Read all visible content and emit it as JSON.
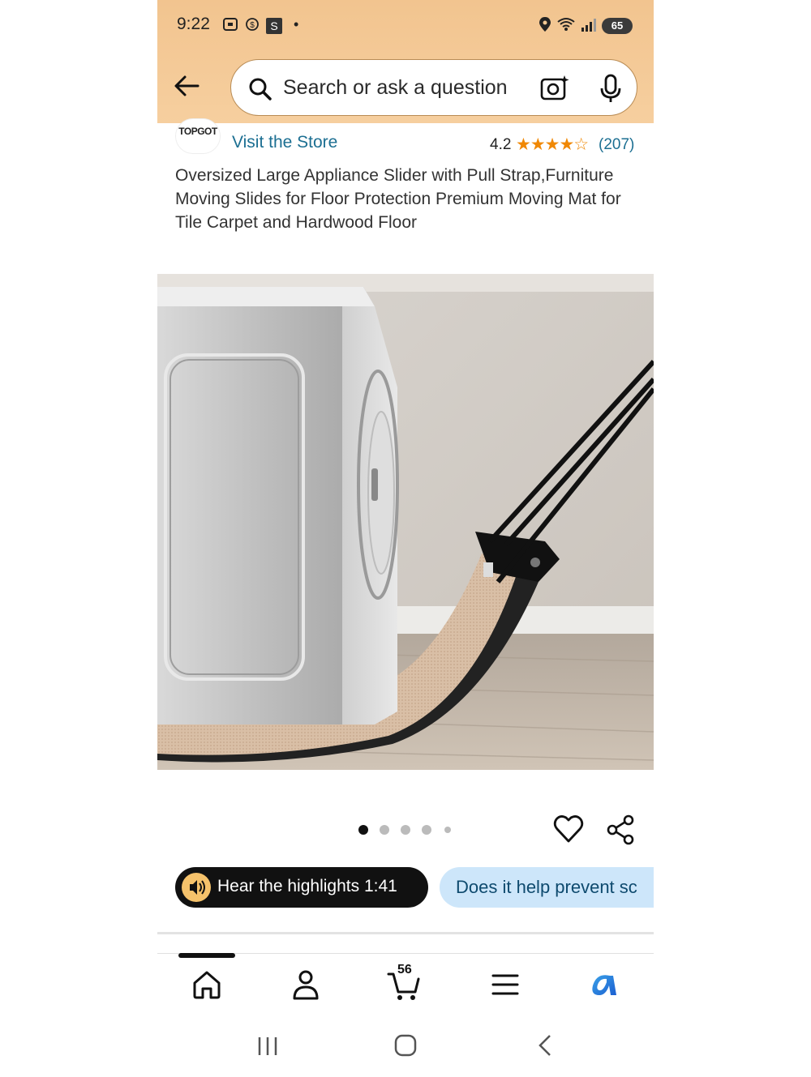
{
  "status_bar": {
    "time": "9:22",
    "notification_letter": "S",
    "battery": "65"
  },
  "search": {
    "placeholder": "Search or ask a question"
  },
  "brand": {
    "logo_text": "TOPGOT",
    "visit_store": "Visit the Store",
    "rating": "4.2",
    "stars": "★★★★☆",
    "review_count": "(207)"
  },
  "product": {
    "title": "Oversized Large Appliance Slider with Pull Strap,Furniture Moving Slides for Floor Protection Premium Moving Mat for Tile Carpet and Hardwood Floor",
    "image_count": 5,
    "active_image": 1
  },
  "actions": {
    "hear_highlights": "Hear the highlights 1:41",
    "question_chip": "Does it help prevent sc"
  },
  "bottom_nav": {
    "items": [
      "home-icon",
      "account-icon",
      "cart-icon",
      "menu-icon",
      "rufus-icon"
    ],
    "cart_count": "56"
  },
  "colors": {
    "header_bg": "#f3c893",
    "link": "#1c6f92",
    "star": "#f08804",
    "chip_bg": "#cde6fa"
  }
}
